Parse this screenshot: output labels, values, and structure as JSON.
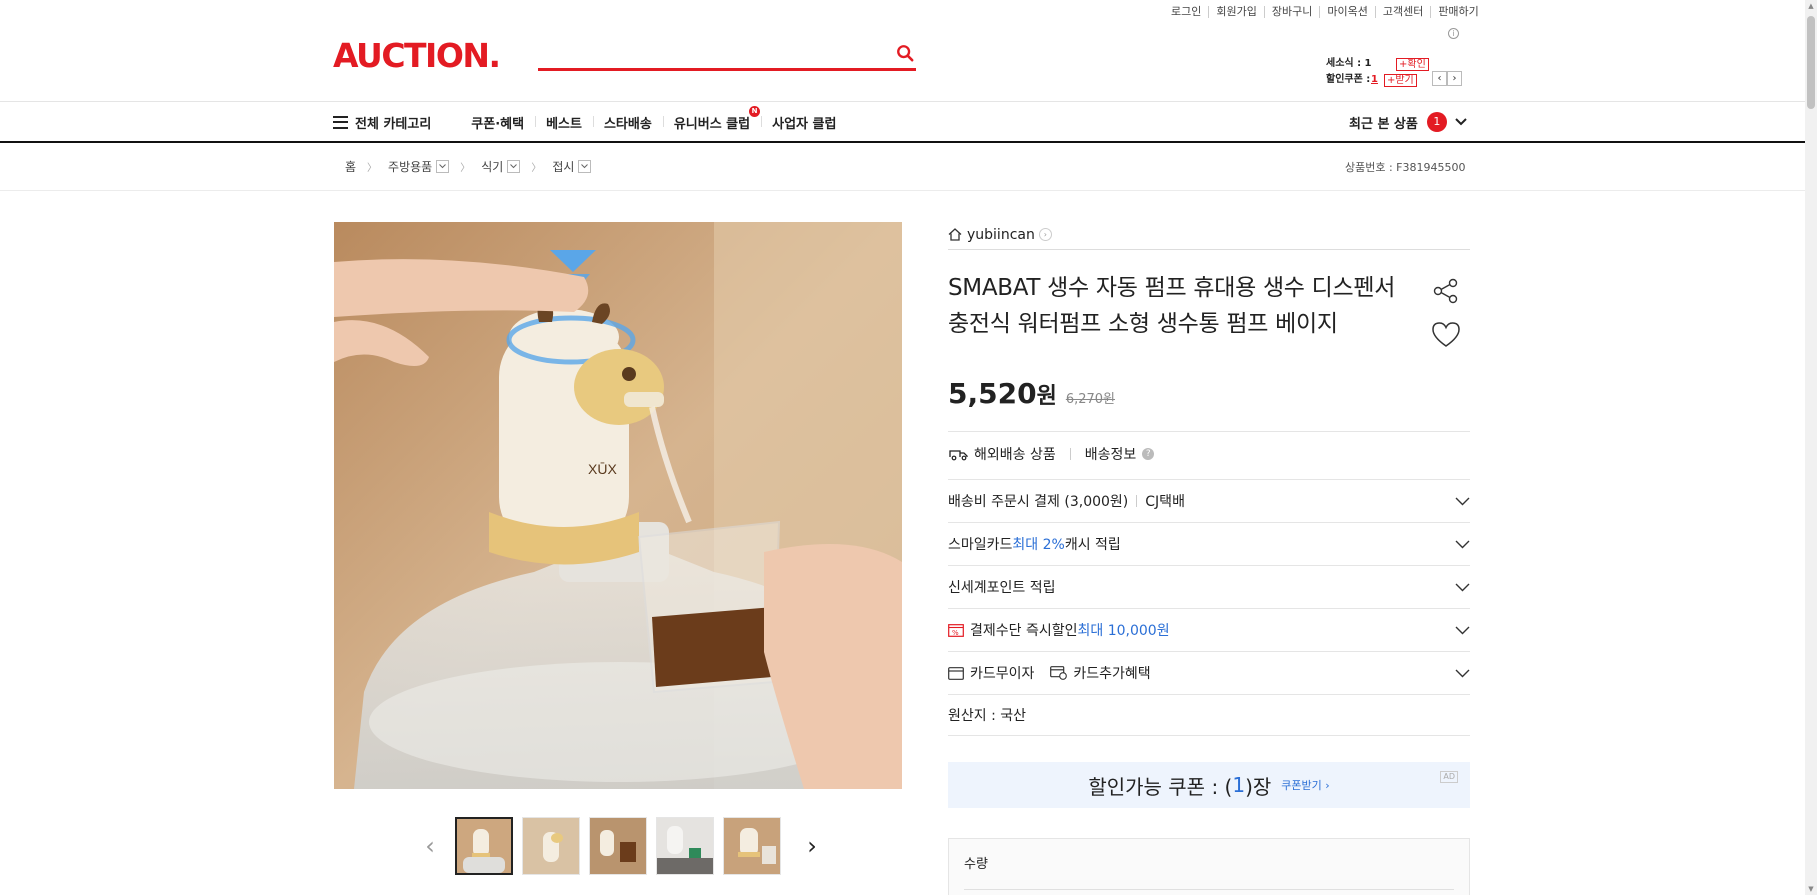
{
  "util_links": [
    "로그인",
    "회원가입",
    "장바구니",
    "마이옥션",
    "고객센터",
    "판매하기"
  ],
  "logo": "AUCTION.",
  "search": {
    "placeholder": ""
  },
  "mini_coupon": {
    "rows": [
      {
        "label": "세소식 : 1",
        "value": "",
        "tag": "+확인"
      },
      {
        "label": "할인쿠폰 :",
        "value": "1",
        "tag": "+받기"
      }
    ]
  },
  "nav": {
    "all_categories": "전체 카테고리",
    "items": [
      "쿠폰·혜택",
      "베스트",
      "스타배송",
      "유니버스 클럽",
      "사업자 클럽"
    ],
    "new_badge": "N",
    "recent_label": "최근 본 상품",
    "recent_count": "1"
  },
  "breadcrumb": {
    "home": "홈",
    "crumbs": [
      "주방용품",
      "식기",
      "접시"
    ],
    "product_no": "상품번호 : F381945500"
  },
  "seller": {
    "name": "yubiincan"
  },
  "product": {
    "title": "SMABAT 생수 자동 펌프 휴대용 생수 디스펜서 충전식 워터펌프 소형 생수통 펌프 베이지",
    "price": "5,520",
    "currency": "원",
    "original_price": "6,270원"
  },
  "shipping": {
    "overseas": "해외배송 상품",
    "info": "배송정보"
  },
  "rows": {
    "shipping_fee": "배송비 주문시 결제 (3,000원)",
    "courier": "CJ택배",
    "smilecard_a": "스마일카드 ",
    "smilecard_b": "최대 2%",
    "smilecard_c": " 캐시 적립",
    "shinsegae": "신세계포인트 적립",
    "payment_a": "결제수단 즉시할인 ",
    "payment_b": "최대 10,000원",
    "card_installment": "카드무이자",
    "card_extra": "카드추가혜택",
    "origin": "원산지 : 국산"
  },
  "coupon_banner": {
    "a": "할인가능 쿠폰 : (",
    "n": "1",
    "b": ")장",
    "get": "쿠폰받기 ›",
    "ad": "AD"
  },
  "quantity": {
    "label": "수량"
  },
  "colors": {
    "brand": "#e31b23",
    "accent_blue": "#2b6fd6"
  }
}
